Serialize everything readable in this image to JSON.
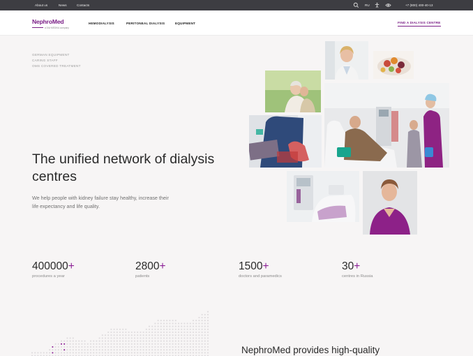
{
  "topbar": {
    "links": [
      "About us",
      "News",
      "Contacts"
    ],
    "lang": "RU",
    "phone": "+7 (800) 400-40-13"
  },
  "header": {
    "logo_name": "NephroMed",
    "logo_tagline": "a DIA·MEDIKA company",
    "nav": [
      "HEMODIALYSIS",
      "PERITONEAL DIALYSIS",
      "EQUIPMENT"
    ],
    "cta": "FIND A DIALYSIS CENTRE"
  },
  "hero": {
    "features": [
      "GERMAN EQUIPMENT",
      "CARING STAFF",
      "OMS COVERED TREATMENT"
    ],
    "title": "The unified network of dialysis centres",
    "subtitle": "We help people with kidney failure stay healthy, increase their life expectancy and life quality."
  },
  "stats": [
    {
      "value": "400000",
      "suffix": "+",
      "label": "procedures a year"
    },
    {
      "value": "2800",
      "suffix": "+",
      "label": "patients"
    },
    {
      "value": "1500",
      "suffix": "+",
      "label": "doctors and paramedics"
    },
    {
      "value": "30",
      "suffix": "+",
      "label": "centres in Russia"
    }
  ],
  "section_title": "NephroMed provides high-quality",
  "colors": {
    "brand": "#7a1e86",
    "accent": "#8b1f95",
    "topbar": "#3d3d42"
  },
  "icons": [
    "search-icon",
    "accessibility-icon",
    "eye-icon"
  ]
}
